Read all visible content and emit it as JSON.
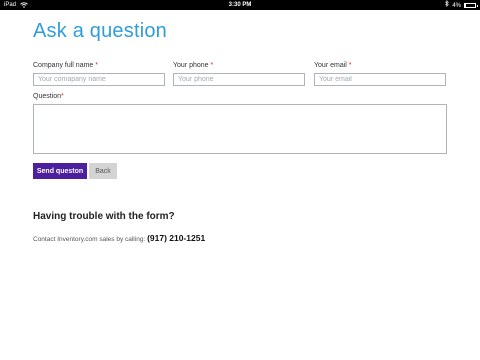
{
  "status_bar": {
    "device": "iPad",
    "time": "3:30 PM",
    "battery_percent": "4%",
    "battery_level": 0.04,
    "icons": [
      "wifi-icon",
      "bluetooth-icon",
      "battery-icon"
    ]
  },
  "page": {
    "title": "Ask a question",
    "title_color": "#2f9ed6"
  },
  "form": {
    "company": {
      "label": "Company full name",
      "required_mark": "*",
      "placeholder": "Your comapany name",
      "value": ""
    },
    "phone": {
      "label": "Your phone",
      "required_mark": "*",
      "placeholder": "Your phone",
      "value": ""
    },
    "email": {
      "label": "Your email",
      "required_mark": "*",
      "placeholder": "Your email",
      "value": ""
    },
    "question": {
      "label": "Question",
      "required_mark": "*",
      "value": ""
    },
    "submit_label": "Send queston",
    "back_label": "Back",
    "submit_color": "#4c1f9e"
  },
  "help": {
    "title": "Having trouble with the form?",
    "text": "Contact Inventory.com sales by calling:",
    "phone": "(917) 210-1251"
  }
}
